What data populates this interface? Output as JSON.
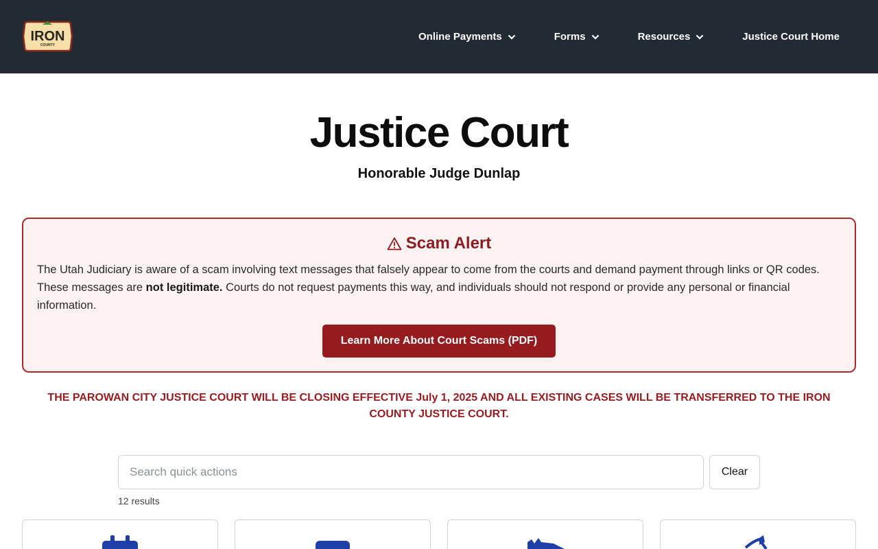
{
  "header": {
    "logo": {
      "name": "IRON",
      "sub": "COUNTY"
    },
    "nav": [
      {
        "label": "Online Payments",
        "has_dropdown": true
      },
      {
        "label": "Forms",
        "has_dropdown": true
      },
      {
        "label": "Resources",
        "has_dropdown": true
      },
      {
        "label": "Justice Court Home",
        "has_dropdown": false
      }
    ]
  },
  "hero": {
    "title": "Justice Court",
    "subtitle": "Honorable Judge Dunlap"
  },
  "alert": {
    "icon": "warning-icon",
    "title": "Scam Alert",
    "text_before": "The Utah Judiciary is aware of a scam involving text messages that falsely appear to come from the courts and demand payment through links or QR codes. These messages are ",
    "text_bold": "not legitimate.",
    "text_after": " Courts do not request payments this way, and individuals should not respond or provide any personal or financial information.",
    "button_label": "Learn More About Court Scams (PDF)"
  },
  "notice": "THE PAROWAN CITY JUSTICE COURT WILL BE CLOSING EFFECTIVE July 1, 2025 AND ALL EXISTING CASES WILL BE TRANSFERRED TO THE IRON COUNTY JUSTICE COURT.",
  "search": {
    "placeholder": "Search quick actions",
    "value": "",
    "clear_label": "Clear",
    "results_text": "12 results"
  },
  "cards": [
    {
      "icon": "calendar-icon"
    },
    {
      "icon": "document-icon"
    },
    {
      "icon": "gavel-icon"
    },
    {
      "icon": "scale-icon"
    }
  ],
  "colors": {
    "header_bg": "#222a33",
    "alert_border": "#b1282b",
    "alert_bg": "#fdf2f2",
    "alert_button": "#961b1e",
    "notice_text": "#9b1c20",
    "icon_blue": "#1f3fa8"
  }
}
